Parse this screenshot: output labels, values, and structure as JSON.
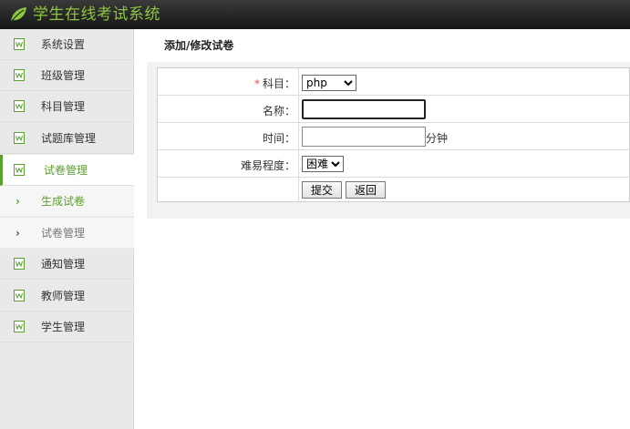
{
  "app": {
    "title": "学生在线考试系统",
    "brand_color": "#8dc63f",
    "logo_icon": "leaf-icon"
  },
  "sidebar": {
    "items": [
      {
        "label": "系统设置",
        "icon": "document-icon"
      },
      {
        "label": "班级管理",
        "icon": "document-icon"
      },
      {
        "label": "科目管理",
        "icon": "document-icon"
      },
      {
        "label": "试题库管理",
        "icon": "document-icon"
      },
      {
        "label": "试卷管理",
        "icon": "document-icon",
        "active": true
      },
      {
        "label": "通知管理",
        "icon": "document-icon"
      },
      {
        "label": "教师管理",
        "icon": "document-icon"
      },
      {
        "label": "学生管理",
        "icon": "document-icon"
      }
    ],
    "subitems": [
      {
        "label": "生成试卷",
        "current": true
      },
      {
        "label": "试卷管理"
      }
    ],
    "active_color": "#5aa02c"
  },
  "main": {
    "title": "添加/修改试卷",
    "form": {
      "subject": {
        "required_mark": "*",
        "label": "科目：",
        "selected": "php"
      },
      "name": {
        "label": "名称：",
        "value": ""
      },
      "time": {
        "label": "时间：",
        "value": "",
        "unit": "分钟"
      },
      "difficulty": {
        "label": "难易程度：",
        "selected": "困难"
      },
      "submit_label": "提交",
      "back_label": "返回"
    }
  }
}
